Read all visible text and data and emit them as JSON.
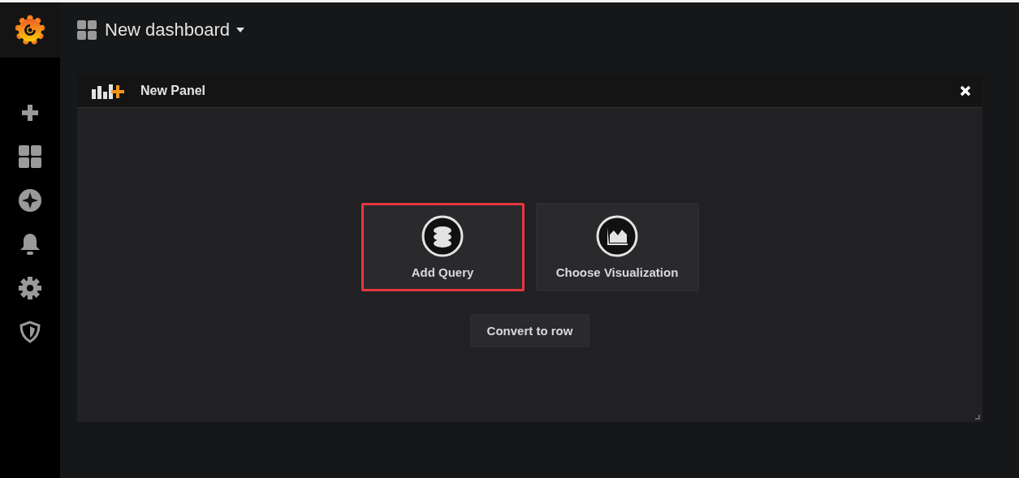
{
  "sidebar": {
    "items": [
      {
        "kind": "plus"
      },
      {
        "kind": "dashboards"
      },
      {
        "kind": "explore"
      },
      {
        "kind": "alerts"
      },
      {
        "kind": "settings"
      },
      {
        "kind": "shield"
      }
    ]
  },
  "header": {
    "title": "New dashboard"
  },
  "panel": {
    "title": "New Panel",
    "actions": [
      {
        "label": "Add Query",
        "kind": "query",
        "highlighted": true
      },
      {
        "label": "Choose Visualization",
        "kind": "visualization",
        "highlighted": false
      }
    ],
    "convert_button": "Convert to row"
  }
}
